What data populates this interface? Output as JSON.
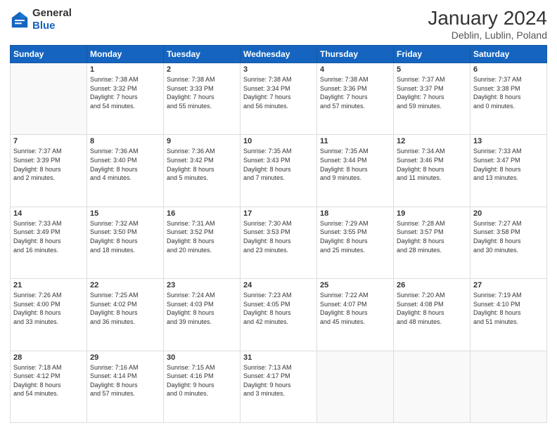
{
  "logo": {
    "general": "General",
    "blue": "Blue"
  },
  "header": {
    "title": "January 2024",
    "subtitle": "Deblin, Lublin, Poland"
  },
  "weekdays": [
    "Sunday",
    "Monday",
    "Tuesday",
    "Wednesday",
    "Thursday",
    "Friday",
    "Saturday"
  ],
  "weeks": [
    [
      {
        "day": "",
        "info": ""
      },
      {
        "day": "1",
        "info": "Sunrise: 7:38 AM\nSunset: 3:32 PM\nDaylight: 7 hours\nand 54 minutes."
      },
      {
        "day": "2",
        "info": "Sunrise: 7:38 AM\nSunset: 3:33 PM\nDaylight: 7 hours\nand 55 minutes."
      },
      {
        "day": "3",
        "info": "Sunrise: 7:38 AM\nSunset: 3:34 PM\nDaylight: 7 hours\nand 56 minutes."
      },
      {
        "day": "4",
        "info": "Sunrise: 7:38 AM\nSunset: 3:36 PM\nDaylight: 7 hours\nand 57 minutes."
      },
      {
        "day": "5",
        "info": "Sunrise: 7:37 AM\nSunset: 3:37 PM\nDaylight: 7 hours\nand 59 minutes."
      },
      {
        "day": "6",
        "info": "Sunrise: 7:37 AM\nSunset: 3:38 PM\nDaylight: 8 hours\nand 0 minutes."
      }
    ],
    [
      {
        "day": "7",
        "info": "Sunrise: 7:37 AM\nSunset: 3:39 PM\nDaylight: 8 hours\nand 2 minutes."
      },
      {
        "day": "8",
        "info": "Sunrise: 7:36 AM\nSunset: 3:40 PM\nDaylight: 8 hours\nand 4 minutes."
      },
      {
        "day": "9",
        "info": "Sunrise: 7:36 AM\nSunset: 3:42 PM\nDaylight: 8 hours\nand 5 minutes."
      },
      {
        "day": "10",
        "info": "Sunrise: 7:35 AM\nSunset: 3:43 PM\nDaylight: 8 hours\nand 7 minutes."
      },
      {
        "day": "11",
        "info": "Sunrise: 7:35 AM\nSunset: 3:44 PM\nDaylight: 8 hours\nand 9 minutes."
      },
      {
        "day": "12",
        "info": "Sunrise: 7:34 AM\nSunset: 3:46 PM\nDaylight: 8 hours\nand 11 minutes."
      },
      {
        "day": "13",
        "info": "Sunrise: 7:33 AM\nSunset: 3:47 PM\nDaylight: 8 hours\nand 13 minutes."
      }
    ],
    [
      {
        "day": "14",
        "info": "Sunrise: 7:33 AM\nSunset: 3:49 PM\nDaylight: 8 hours\nand 16 minutes."
      },
      {
        "day": "15",
        "info": "Sunrise: 7:32 AM\nSunset: 3:50 PM\nDaylight: 8 hours\nand 18 minutes."
      },
      {
        "day": "16",
        "info": "Sunrise: 7:31 AM\nSunset: 3:52 PM\nDaylight: 8 hours\nand 20 minutes."
      },
      {
        "day": "17",
        "info": "Sunrise: 7:30 AM\nSunset: 3:53 PM\nDaylight: 8 hours\nand 23 minutes."
      },
      {
        "day": "18",
        "info": "Sunrise: 7:29 AM\nSunset: 3:55 PM\nDaylight: 8 hours\nand 25 minutes."
      },
      {
        "day": "19",
        "info": "Sunrise: 7:28 AM\nSunset: 3:57 PM\nDaylight: 8 hours\nand 28 minutes."
      },
      {
        "day": "20",
        "info": "Sunrise: 7:27 AM\nSunset: 3:58 PM\nDaylight: 8 hours\nand 30 minutes."
      }
    ],
    [
      {
        "day": "21",
        "info": "Sunrise: 7:26 AM\nSunset: 4:00 PM\nDaylight: 8 hours\nand 33 minutes."
      },
      {
        "day": "22",
        "info": "Sunrise: 7:25 AM\nSunset: 4:02 PM\nDaylight: 8 hours\nand 36 minutes."
      },
      {
        "day": "23",
        "info": "Sunrise: 7:24 AM\nSunset: 4:03 PM\nDaylight: 8 hours\nand 39 minutes."
      },
      {
        "day": "24",
        "info": "Sunrise: 7:23 AM\nSunset: 4:05 PM\nDaylight: 8 hours\nand 42 minutes."
      },
      {
        "day": "25",
        "info": "Sunrise: 7:22 AM\nSunset: 4:07 PM\nDaylight: 8 hours\nand 45 minutes."
      },
      {
        "day": "26",
        "info": "Sunrise: 7:20 AM\nSunset: 4:08 PM\nDaylight: 8 hours\nand 48 minutes."
      },
      {
        "day": "27",
        "info": "Sunrise: 7:19 AM\nSunset: 4:10 PM\nDaylight: 8 hours\nand 51 minutes."
      }
    ],
    [
      {
        "day": "28",
        "info": "Sunrise: 7:18 AM\nSunset: 4:12 PM\nDaylight: 8 hours\nand 54 minutes."
      },
      {
        "day": "29",
        "info": "Sunrise: 7:16 AM\nSunset: 4:14 PM\nDaylight: 8 hours\nand 57 minutes."
      },
      {
        "day": "30",
        "info": "Sunrise: 7:15 AM\nSunset: 4:16 PM\nDaylight: 9 hours\nand 0 minutes."
      },
      {
        "day": "31",
        "info": "Sunrise: 7:13 AM\nSunset: 4:17 PM\nDaylight: 9 hours\nand 3 minutes."
      },
      {
        "day": "",
        "info": ""
      },
      {
        "day": "",
        "info": ""
      },
      {
        "day": "",
        "info": ""
      }
    ]
  ]
}
